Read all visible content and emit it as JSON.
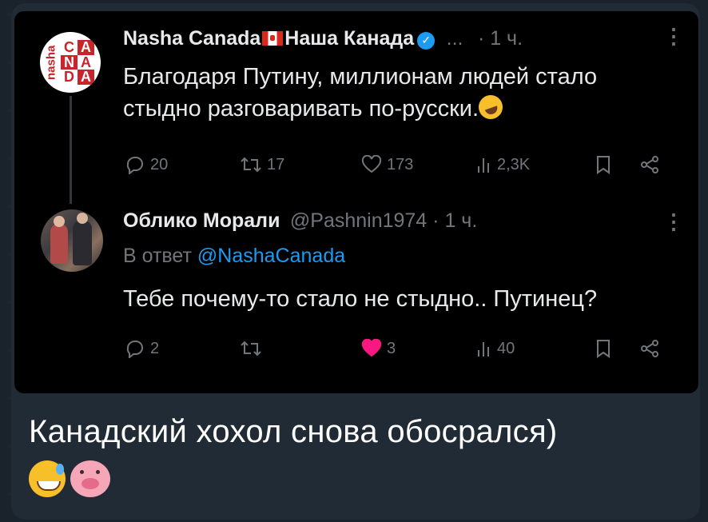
{
  "tweet1": {
    "display_name_part1": "Nasha Canada",
    "display_name_part2": "Наша Канада",
    "more": "...",
    "time": "· 1 ч.",
    "text_line1": "Благодаря Путину, миллионам людей стало",
    "text_line2": "стыдно разговаривать по-русски.",
    "avatar": {
      "side_text": "nasha",
      "letters": [
        "C",
        "A",
        "N",
        "A",
        "D",
        "A"
      ]
    },
    "actions": {
      "replies": "20",
      "retweets": "17",
      "likes": "173",
      "views": "2,3K"
    }
  },
  "tweet2": {
    "display_name": "Облико Морали",
    "handle_time": "@Pashnin1974 · 1 ч.",
    "reply_prefix": "В ответ",
    "reply_to": "@NashaCanada",
    "text": "Тебе почему-то стало не стыдно.. Путинец?",
    "actions": {
      "replies": "2",
      "retweets": "",
      "likes": "3",
      "views": "40"
    }
  },
  "caption": "Канадский хохол снова обосрался)",
  "colors": {
    "link": "#1d9bf0",
    "muted": "#71767b",
    "like_active": "#f91880",
    "card_bg": "#000000",
    "chat_bg": "#202b36"
  },
  "icons": [
    "reply-icon",
    "retweet-icon",
    "like-icon",
    "views-icon",
    "bookmark-icon",
    "share-icon",
    "verified-icon",
    "more-icon"
  ]
}
